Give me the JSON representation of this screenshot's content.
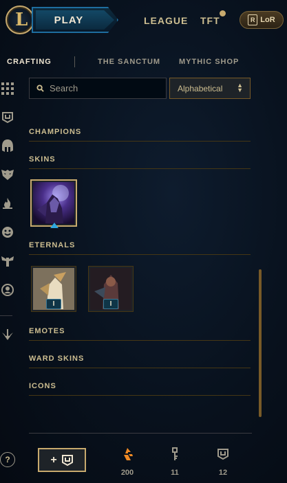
{
  "header": {
    "play_label": "PLAY",
    "nav": [
      {
        "label": "LEAGUE"
      },
      {
        "label": "TFT"
      }
    ],
    "lor_label": "LoR",
    "tft_has_notification": true
  },
  "subnav": {
    "tabs": [
      {
        "label": "CRAFTING",
        "active": true
      },
      {
        "label": "THE SANCTUM",
        "active": false
      },
      {
        "label": "MYTHIC SHOP",
        "active": false
      }
    ]
  },
  "sidebar": {
    "items": [
      {
        "icon": "grid-icon"
      },
      {
        "icon": "chest-icon"
      },
      {
        "icon": "helmet-icon"
      },
      {
        "icon": "mask-icon"
      },
      {
        "icon": "flame-icon"
      },
      {
        "icon": "emote-icon"
      },
      {
        "icon": "ward-icon"
      },
      {
        "icon": "profile-icon"
      },
      {
        "icon": "arrow-down-icon"
      }
    ]
  },
  "search": {
    "placeholder": "Search",
    "value": ""
  },
  "sort": {
    "selected": "Alphabetical"
  },
  "sections": {
    "champions": "CHAMPIONS",
    "skins": "SKINS",
    "eternals": "ETERNALS",
    "emotes": "EMOTES",
    "ward_skins": "WARD SKINS",
    "icons": "ICONS"
  },
  "eternals": [
    {
      "tier": "I"
    },
    {
      "tier": "I"
    }
  ],
  "footer": {
    "help_label": "?",
    "add_label": "+",
    "currencies": [
      {
        "icon": "orange-essence-icon",
        "value": "200"
      },
      {
        "icon": "key-icon",
        "value": "11"
      },
      {
        "icon": "chest-icon",
        "value": "12"
      }
    ]
  },
  "colors": {
    "gold": "#c8aa6e",
    "blue_accent": "#2ea7e0",
    "orange_essence": "#f08a24"
  }
}
